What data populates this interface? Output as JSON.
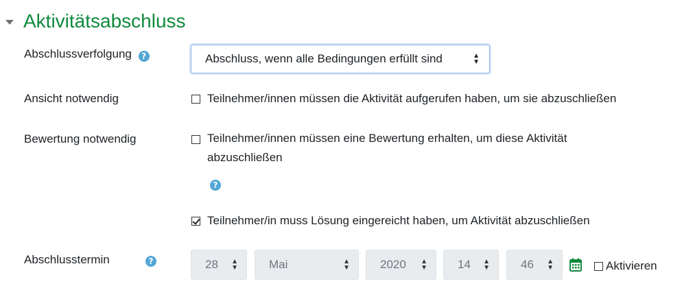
{
  "section": {
    "title": "Aktivitätsabschluss"
  },
  "completion_tracking": {
    "label": "Abschlussverfolgung",
    "help_icon": "question-circle-icon",
    "selected": "Abschluss, wenn alle Bedingungen erfüllt sind"
  },
  "view_required": {
    "label": "Ansicht notwendig",
    "checkbox_label": "Teilnehmer/innen müssen die Aktivität aufgerufen haben, um sie abzuschließen",
    "checked": false
  },
  "grade_required": {
    "label": "Bewertung notwendig",
    "checkbox_label_line1": "Teilnehmer/innen müssen eine Bewertung erhalten, um diese Aktivität",
    "checkbox_label_line2": "abzuschließen",
    "checked": false
  },
  "submit_required": {
    "checkbox_label": "Teilnehmer/in muss Lösung eingereicht haben, um Aktivität abzuschließen",
    "checked": true
  },
  "expected_completion": {
    "label": "Abschlusstermin",
    "day": "28",
    "month": "Mai",
    "year": "2020",
    "hour": "14",
    "minute": "46",
    "enable_label": "Aktivieren",
    "enabled": false
  },
  "colors": {
    "title": "#0f8a3c",
    "help": "#52a7d6",
    "calendar": "#0f8a3c"
  }
}
